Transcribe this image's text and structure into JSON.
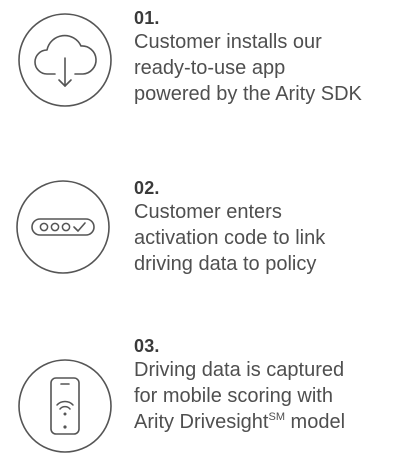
{
  "steps": [
    {
      "number": "01.",
      "icon": "cloud-download-icon",
      "lines": [
        "Customer installs our",
        "ready-to-use app",
        "powered by the Arity SDK"
      ]
    },
    {
      "number": "02.",
      "icon": "password-check-icon",
      "lines": [
        "Customer enters",
        "activation code to link",
        "driving data to policy"
      ]
    },
    {
      "number": "03.",
      "icon": "phone-wifi-icon",
      "lines": [
        "Driving data is captured",
        "for mobile scoring with"
      ],
      "last_line": {
        "prefix": "Arity Drivesight",
        "superscript": "SM",
        "suffix": " model"
      }
    }
  ],
  "colors": {
    "icon_stroke": "#555555",
    "text": "#4f4f4f",
    "heading": "#3a3a3a"
  }
}
